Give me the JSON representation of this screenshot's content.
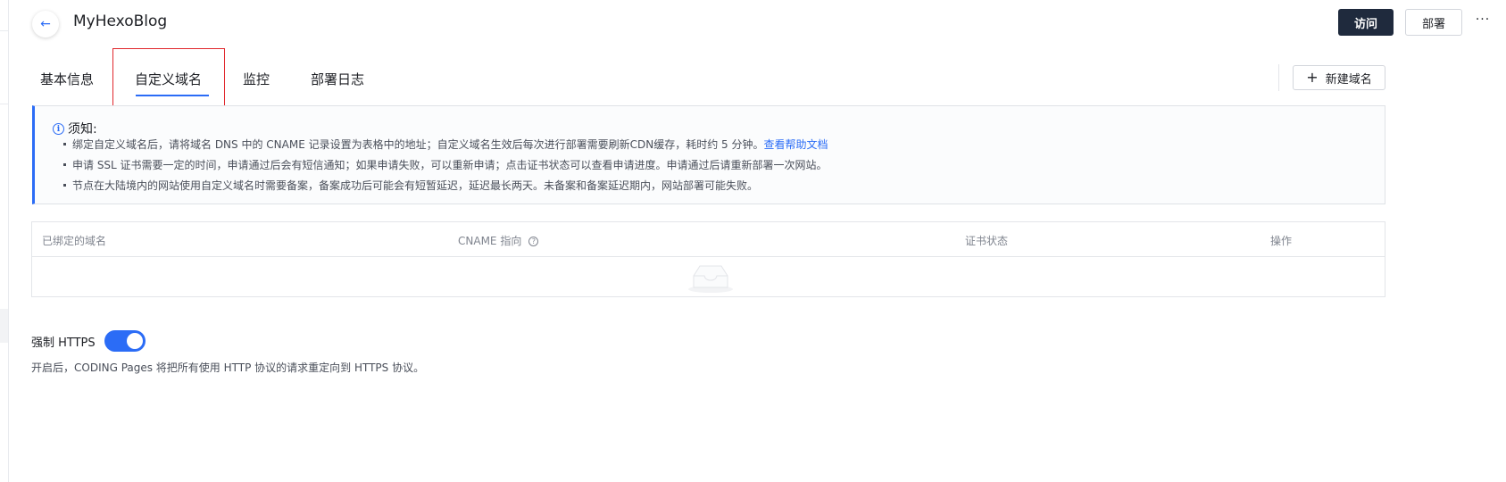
{
  "header": {
    "back_icon": "arrow-left-icon",
    "title": "MyHexoBlog",
    "visit_label": "访问",
    "deploy_label": "部署",
    "more_label": "···"
  },
  "tabs": [
    {
      "label": "基本信息",
      "active": false
    },
    {
      "label": "自定义域名",
      "active": true
    },
    {
      "label": "监控",
      "active": false
    },
    {
      "label": "部署日志",
      "active": false
    }
  ],
  "new_domain_label": "新建域名",
  "notice": {
    "title": "须知:",
    "items": [
      "绑定自定义域名后，请将域名 DNS 中的 CNAME 记录设置为表格中的地址；自定义域名生效后每次进行部署需要刷新CDN缓存，耗时约 5 分钟。",
      "申请 SSL 证书需要一定的时间，申请通过后会有短信通知；如果申请失败，可以重新申请；点击证书状态可以查看申请进度。申请通过后请重新部署一次网站。",
      "节点在大陆境内的网站使用自定义域名时需要备案，备案成功后可能会有短暂延迟，延迟最长两天。未备案和备案延迟期内，网站部署可能失败。"
    ],
    "help_link": "查看帮助文档"
  },
  "table": {
    "columns": [
      "已绑定的域名",
      "CNAME 指向",
      "证书状态",
      "操作"
    ],
    "rows": []
  },
  "https": {
    "label": "强制 HTTPS",
    "enabled": true,
    "description": "开启后，CODING Pages 将把所有使用 HTTP 协议的请求重定向到 HTTPS 协议。"
  },
  "colors": {
    "accent": "#2b6cf6",
    "primary_button": "#1f2a3d",
    "highlight_box": "#e0262b"
  }
}
